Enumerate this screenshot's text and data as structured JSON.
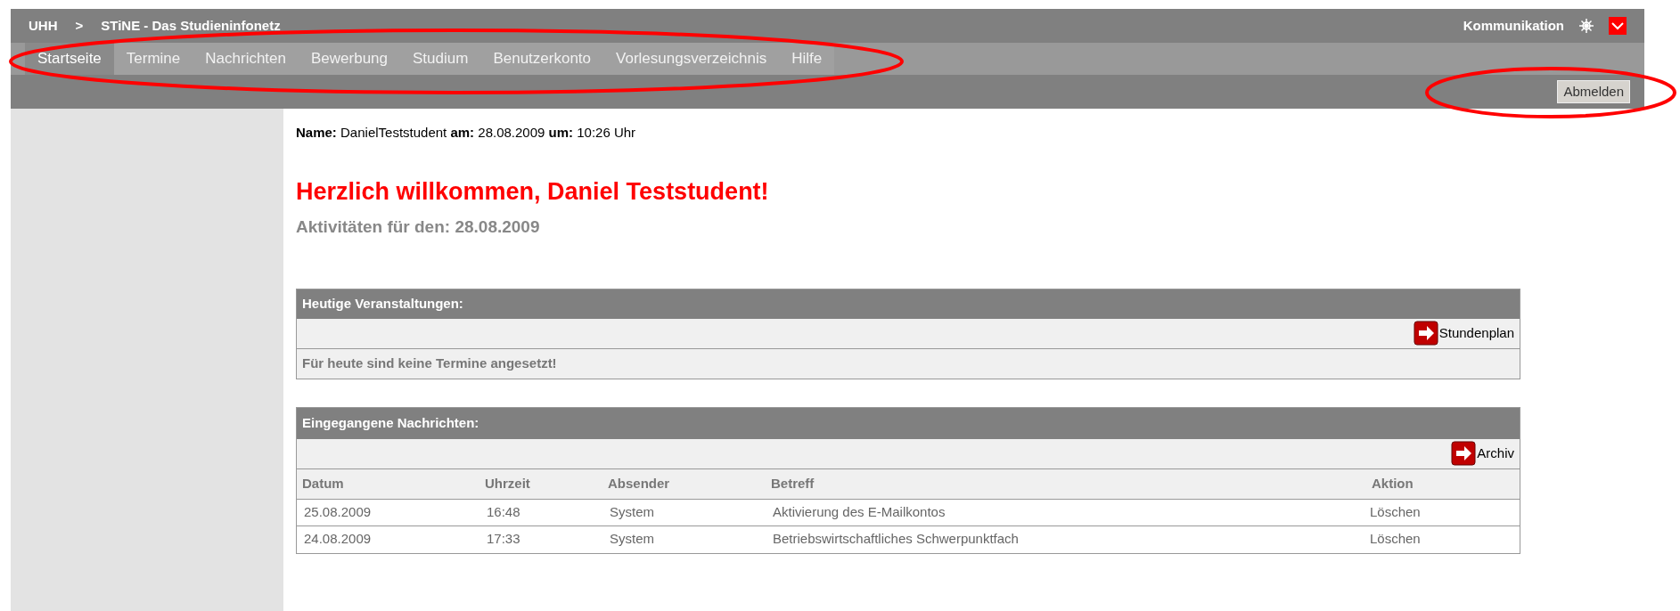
{
  "header": {
    "breadcrumb": [
      {
        "label": "UHH"
      },
      {
        "label": ">"
      },
      {
        "label": "STiNE - Das Studieninfonetz"
      }
    ],
    "communication": "Kommunikation"
  },
  "nav": [
    {
      "label": "Startseite",
      "selected": true
    },
    {
      "label": "Termine",
      "selected": false
    },
    {
      "label": "Nachrichten",
      "selected": false
    },
    {
      "label": "Bewerbung",
      "selected": false
    },
    {
      "label": "Studium",
      "selected": false
    },
    {
      "label": "Benutzerkonto",
      "selected": false
    },
    {
      "label": "Vorlesungsverzeichnis",
      "selected": false
    },
    {
      "label": "Hilfe",
      "selected": false
    }
  ],
  "logout_button": "Abmelden",
  "info": "**Name:** DanielTeststudent **am:** 28.08.2009 **um:** 10:26 Uhr",
  "welcome": "Herzlich willkommen, Daniel Teststudent!",
  "activities_heading": "Aktivitäten für den: 28.08.2009",
  "events": {
    "title": "Heutige Veranstaltungen:",
    "link": "Stundenplan",
    "message": "Für heute sind keine Termine angesetzt!"
  },
  "messages": {
    "title": "Eingegangene Nachrichten:",
    "link": "Archiv",
    "columns": [
      "Datum",
      "Uhrzeit",
      "Absender",
      "Betreff",
      "Aktion"
    ],
    "rows": [
      [
        "25.08.2009",
        "16:48",
        "System",
        "Aktivierung des E-Mailkontos",
        "Löschen"
      ],
      [
        "24.08.2009",
        "17:33",
        "System",
        "Betriebswirtschaftliches Schwerpunktfach",
        "Löschen"
      ]
    ]
  }
}
